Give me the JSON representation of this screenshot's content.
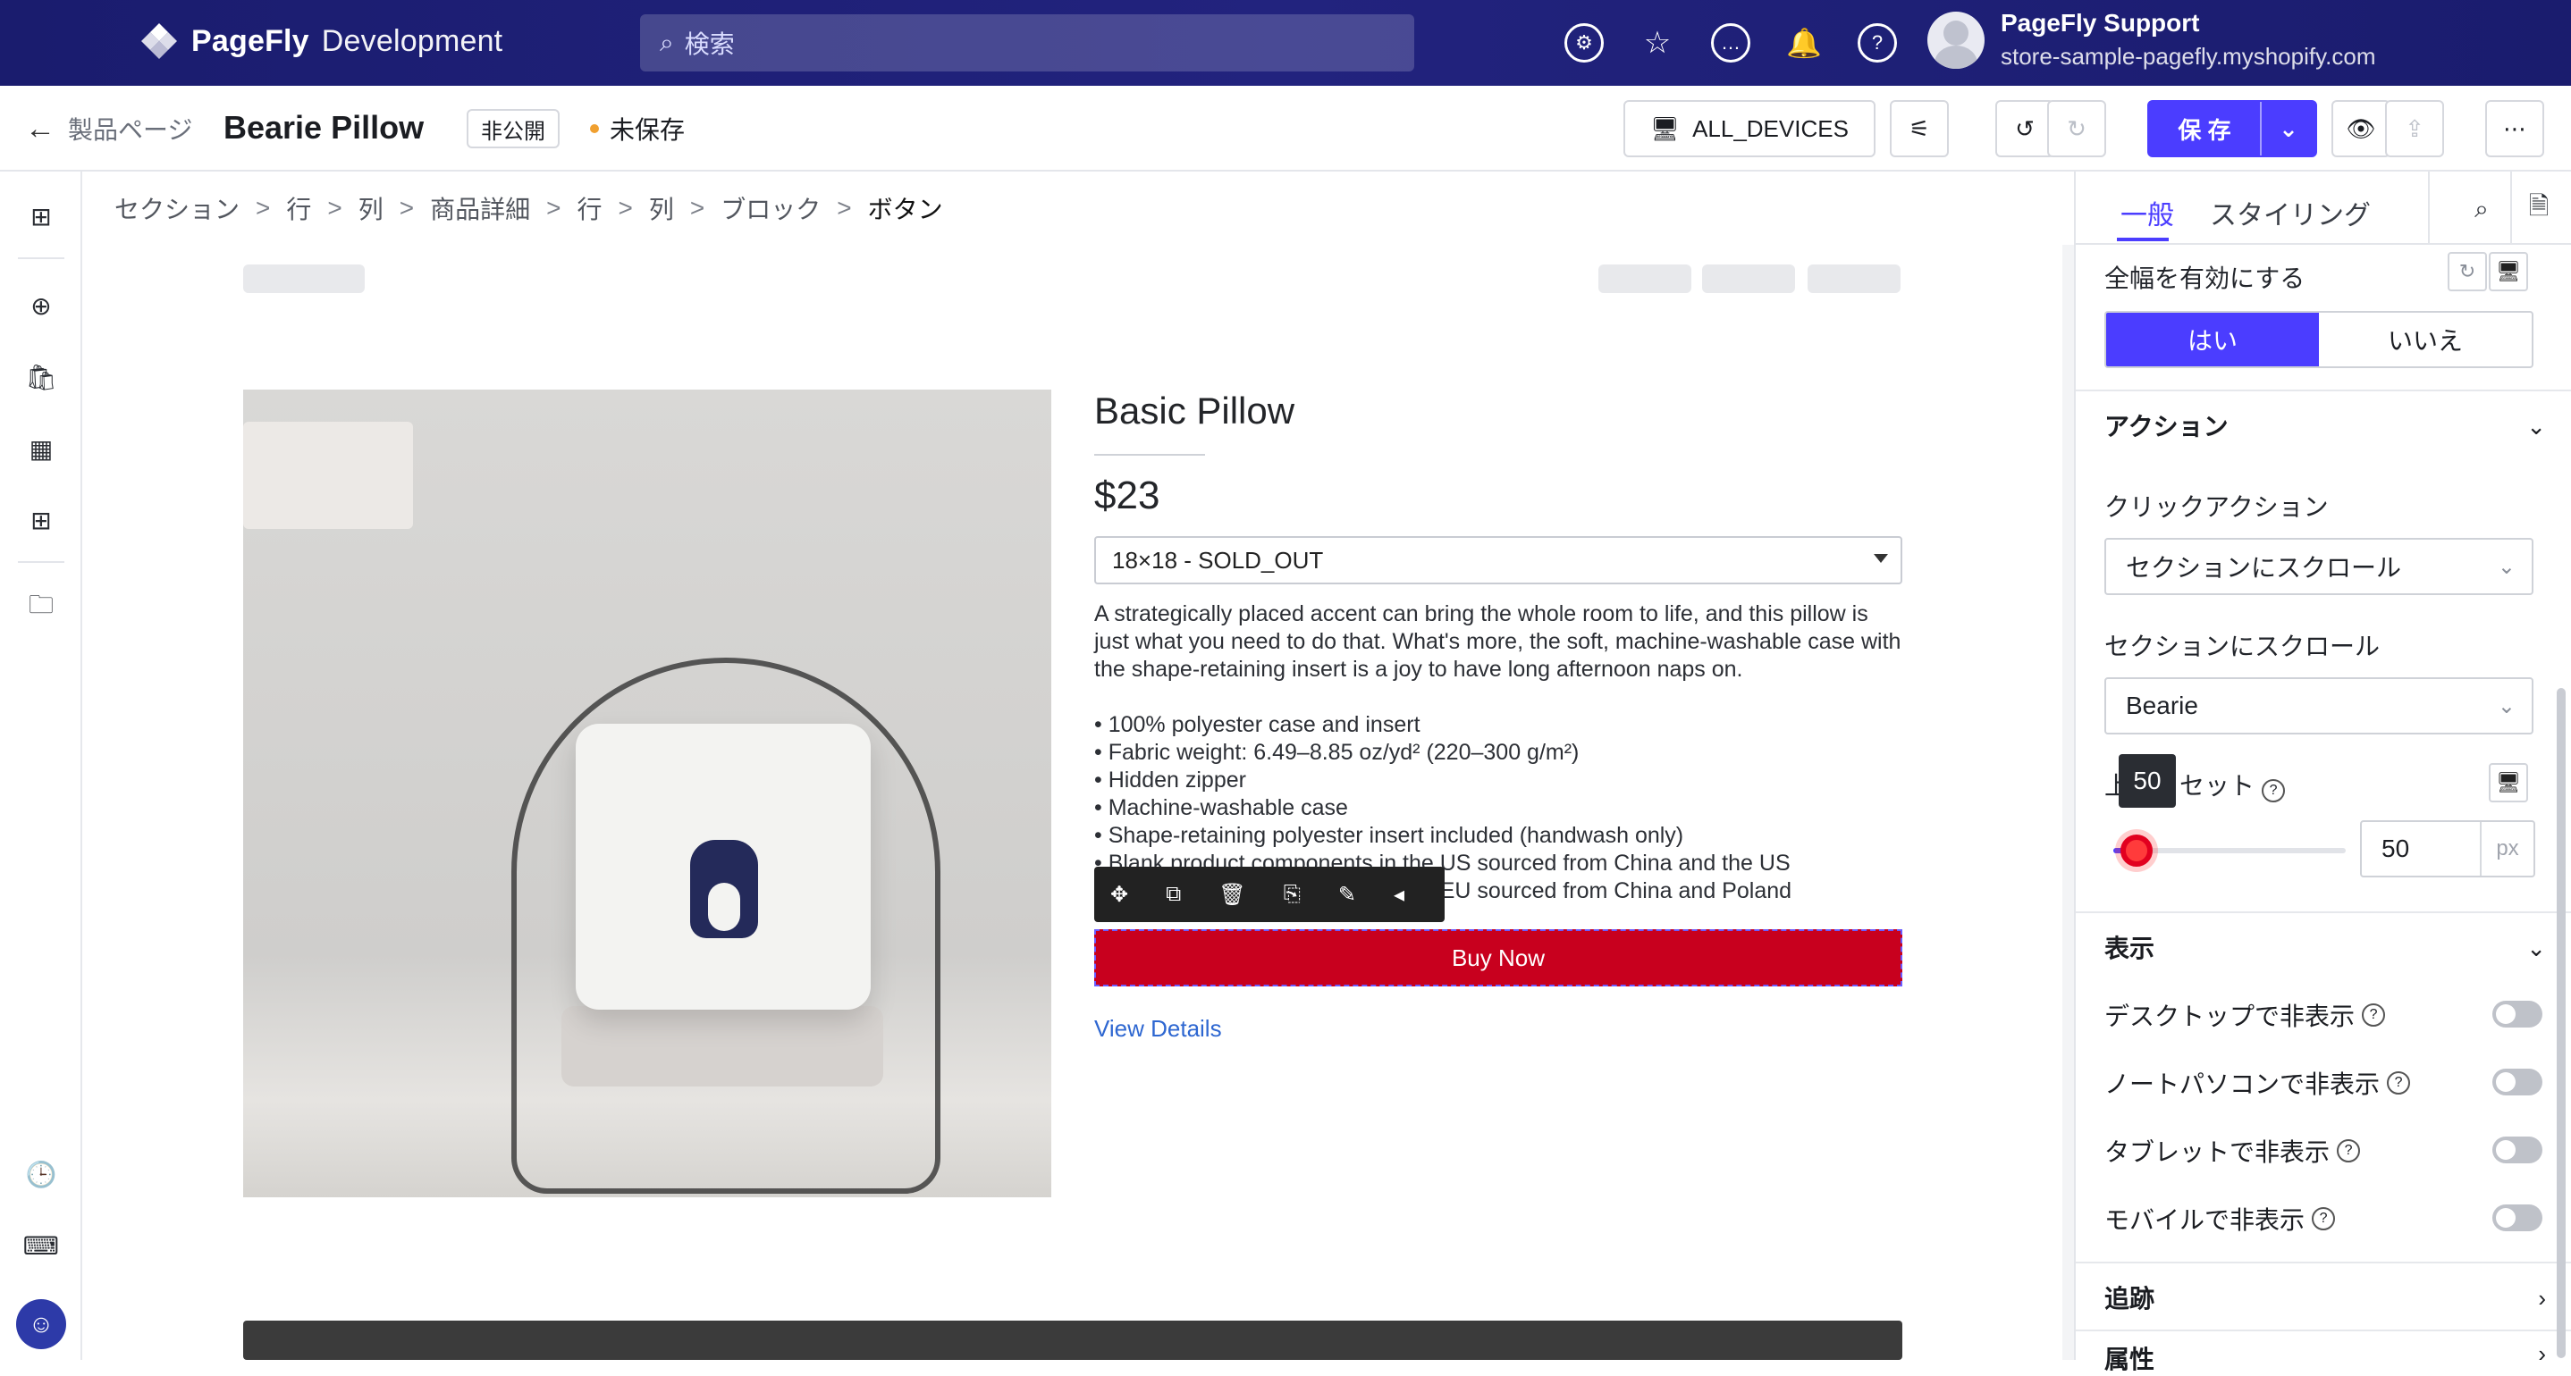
{
  "app": {
    "logo_name": "PageFly",
    "logo_env": "Development",
    "search_placeholder": "検索",
    "user_name": "PageFly Support",
    "store_domain": "store-sample-pagefly.myshopify.com",
    "top_icons": [
      "settings-icon",
      "star-icon",
      "chat-icon",
      "bell-icon",
      "help-icon"
    ]
  },
  "pagebar": {
    "back_label": "製品ページ",
    "title": "Bearie Pillow",
    "status_badge": "非公開",
    "unsaved_label": "未保存",
    "device_label": "ALL_DEVICES",
    "save_label": "保 存"
  },
  "breadcrumb": [
    "セクション",
    "行",
    "列",
    "商品詳細",
    "行",
    "列",
    "ブロック",
    "ボタン"
  ],
  "product": {
    "title": "Basic Pillow",
    "price": "$23",
    "variant": "18×18 - SOLD_OUT",
    "intro": "A strategically placed accent can bring the whole room to life, and this pillow is just what you need to do that. What's more, the soft, machine-washable case with the shape-retaining insert is a joy to have long afternoon naps on.",
    "bullets": [
      "• 100% polyester case and insert",
      "• Fabric weight: 6.49–8.85 oz/yd² (220–300 g/m²)",
      "• Hidden zipper",
      "• Machine-washable case",
      "• Shape-retaining polyester insert included (handwash only)",
      "• Blank product components in the US sourced from China and the US",
      "• Blank product components in the EU sourced from China and Poland"
    ],
    "buy_label": "Buy Now",
    "details_label": "View Details"
  },
  "panel": {
    "tab_general": "一般",
    "tab_styling": "スタイリング",
    "full_width_label": "全幅を有効にする",
    "yes": "はい",
    "no": "いいえ",
    "section_action": "アクション",
    "click_action_label": "クリックアクション",
    "click_action_value": "セクションにスクロール",
    "scroll_section_label": "セクションにスクロール",
    "scroll_section_value": "Bearie",
    "offset_label": "上オフセット",
    "offset_tooltip": "50",
    "offset_value": "50",
    "offset_unit": "px",
    "offset_fraction": 0.1,
    "section_display": "表示",
    "hide_desktop": "デスクトップで非表示",
    "hide_laptop": "ノートパソコンで非表示",
    "hide_tablet": "タブレットで非表示",
    "hide_mobile": "モバイルで非表示",
    "section_tracking": "追跡",
    "section_attributes": "属性"
  },
  "colors": {
    "accent": "#4b3dff",
    "buy_button": "#c8001e",
    "topbar": "#1d1f7a"
  }
}
